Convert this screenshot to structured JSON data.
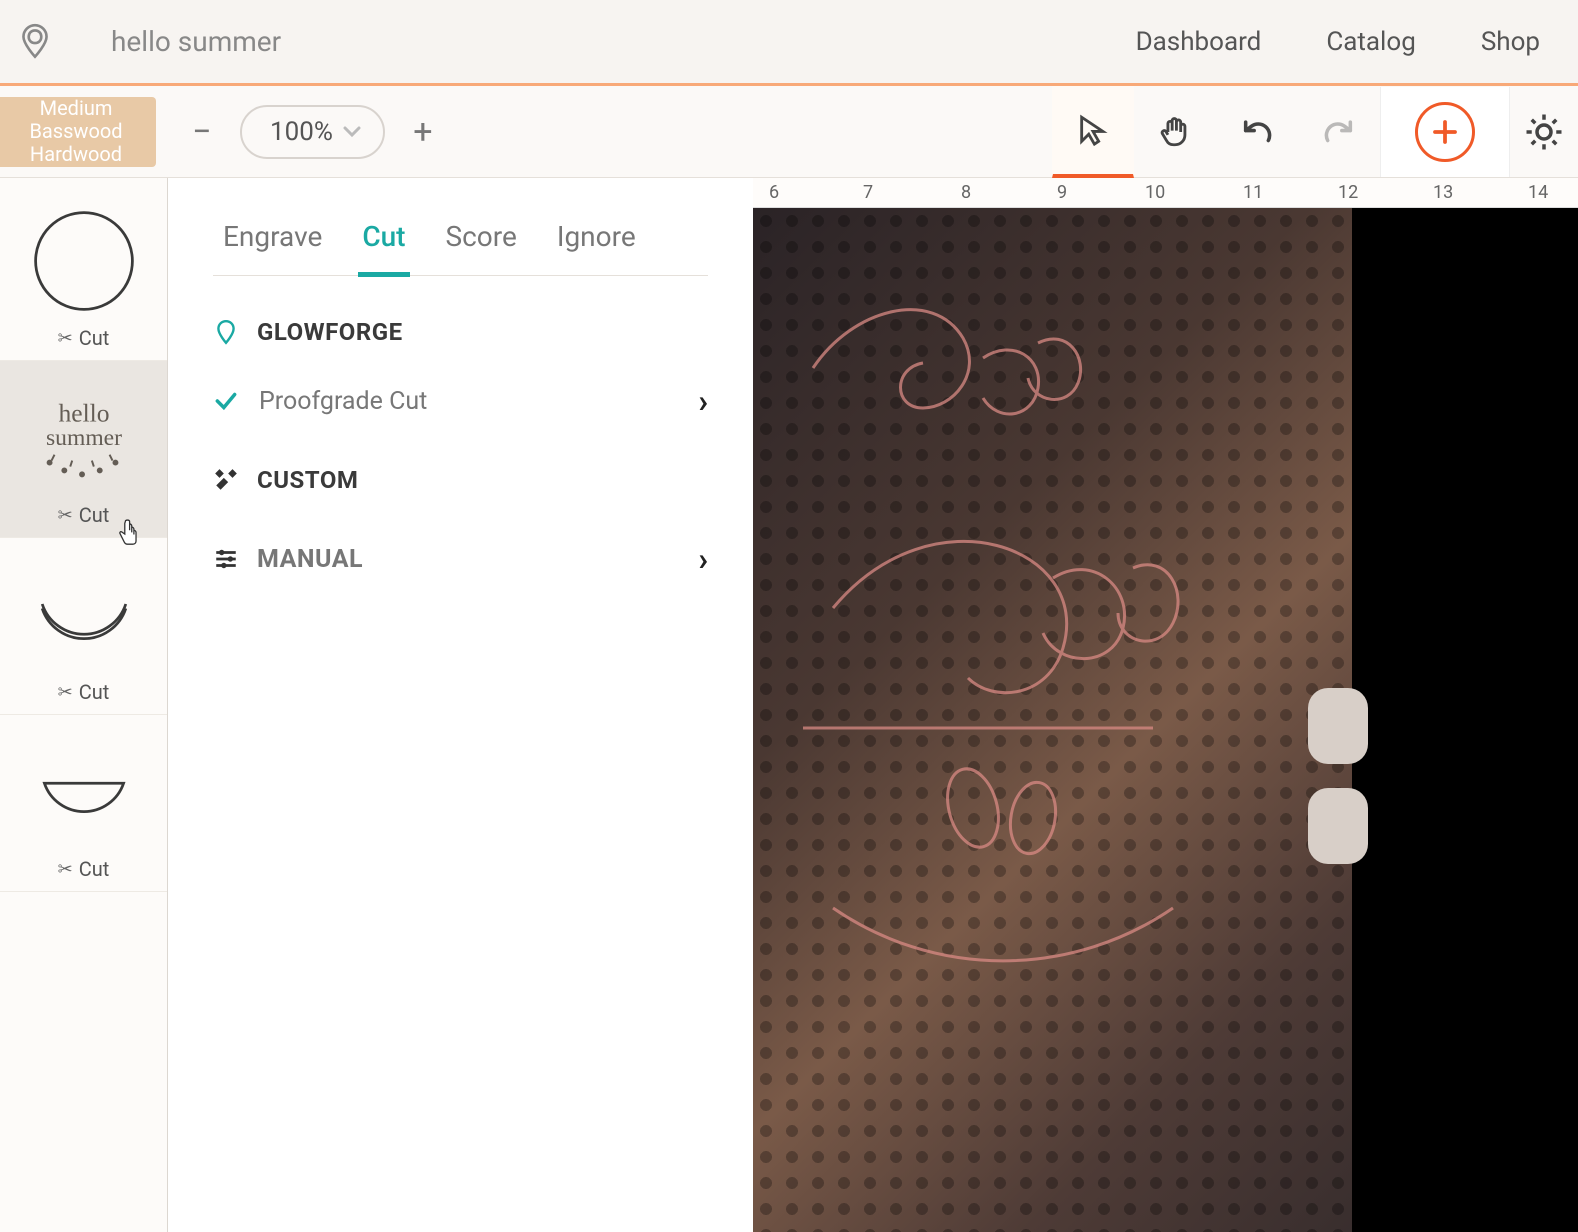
{
  "header": {
    "project_title": "hello summer",
    "nav": {
      "dashboard": "Dashboard",
      "catalog": "Catalog",
      "shop": "Shop"
    }
  },
  "toolbar": {
    "material_line1": "Medium",
    "material_line2": "Basswood",
    "material_line3": "Hardwood",
    "zoom": "100%"
  },
  "sidebar": {
    "layers": [
      {
        "label": "Cut"
      },
      {
        "label": "Cut"
      },
      {
        "label": "Cut"
      },
      {
        "label": "Cut"
      }
    ]
  },
  "panel": {
    "tabs": {
      "engrave": "Engrave",
      "cut": "Cut",
      "score": "Score",
      "ignore": "Ignore"
    },
    "section_glowforge": "GLOWFORGE",
    "proofgrade": "Proofgrade Cut",
    "section_custom": "CUSTOM",
    "section_manual": "MANUAL"
  },
  "ruler": {
    "marks": [
      "6",
      "7",
      "8",
      "9",
      "10",
      "11",
      "12",
      "13",
      "14"
    ]
  }
}
